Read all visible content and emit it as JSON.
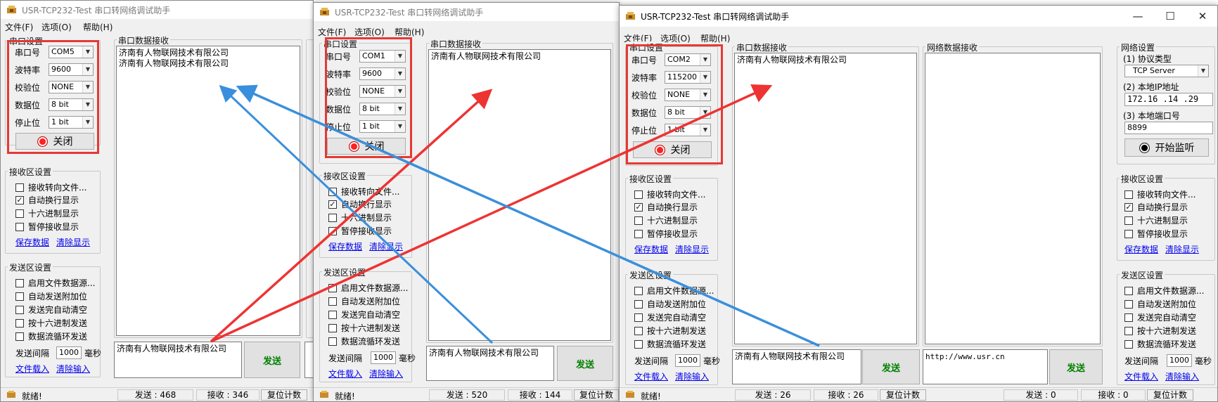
{
  "app": {
    "title": "USR-TCP232-Test 串口转网络调试助手",
    "menus": [
      "文件(F)",
      "选项(O)",
      "帮助(H)"
    ]
  },
  "labels": {
    "serial_settings": "串口设置",
    "serial_recv": "串口数据接收",
    "net_recv": "网络数据接收",
    "net_settings": "网络设置",
    "port": "串口号",
    "baud": "波特率",
    "parity": "校验位",
    "databits": "数据位",
    "stopbits": "停止位",
    "close_btn": "关闭",
    "recv_settings": "接收区设置",
    "recv_to_file": "接收转向文件...",
    "auto_newline": "自动换行显示",
    "hex_display": "十六进制显示",
    "pause_recv": "暂停接收显示",
    "save_data": "保存数据",
    "clear_display": "清除显示",
    "send_settings": "发送区设置",
    "file_source": "启用文件数据源...",
    "auto_append": "自动发送附加位",
    "auto_clear": "发送完自动清空",
    "hex_send": "按十六进制发送",
    "loop_send": "数据流循环发送",
    "send_interval": "发送间隔",
    "ms": "毫秒",
    "file_load": "文件载入",
    "clear_input": "清除输入",
    "send_btn": "发送",
    "status_ready": "就绪!",
    "reset_count": "复位计数",
    "protocol_type": "(1) 协议类型",
    "local_ip": "(2) 本地IP地址",
    "local_port": "(3) 本地端口号",
    "start_listen": "开始监听"
  },
  "window1": {
    "port": "COM5",
    "baud": "9600",
    "parity": "NONE",
    "databits": "8 bit",
    "stopbits": "1 bit",
    "recv_lines": [
      "济南有人物联网技术有限公司",
      "济南有人物联网技术有限公司"
    ],
    "send_text": "济南有人物联网技术有限公司",
    "interval": "1000",
    "sent": "发送 : 468",
    "received": "接收 : 346",
    "auto_newline_checked": true
  },
  "window2": {
    "port": "COM1",
    "baud": "9600",
    "parity": "NONE",
    "databits": "8 bit",
    "stopbits": "1 bit",
    "recv_lines": [
      "济南有人物联网技术有限公司"
    ],
    "send_text": "济南有人物联网技术有限公司",
    "interval": "1000",
    "sent": "发送 : 520",
    "received": "接收 : 144",
    "auto_newline_checked": true
  },
  "window3": {
    "port": "COM2",
    "baud": "115200",
    "parity": "NONE",
    "databits": "8 bit",
    "stopbits": "1 bit",
    "recv_lines": [
      "济南有人物联网技术有限公司"
    ],
    "send_text": "济南有人物联网技术有限公司",
    "net_send_text": "http://www.usr.cn",
    "interval": "1000",
    "net_interval": "1000",
    "sent": "发送 : 26",
    "received": "接收 : 26",
    "net_sent": "发送 : 0",
    "net_received": "接收 : 0",
    "protocol": "TCP Server",
    "ip": "172.16 .14 .29",
    "local_port_value": "8899",
    "auto_newline_checked": true
  },
  "window_controls": {
    "minimize": "—",
    "maximize": "☐",
    "close": "✕"
  },
  "colors": {
    "highlight_box": "#e53935",
    "arrow_red": "#ee3333",
    "arrow_blue": "#3a8fdc",
    "send_text": "#008000",
    "link": "#0000ee"
  }
}
